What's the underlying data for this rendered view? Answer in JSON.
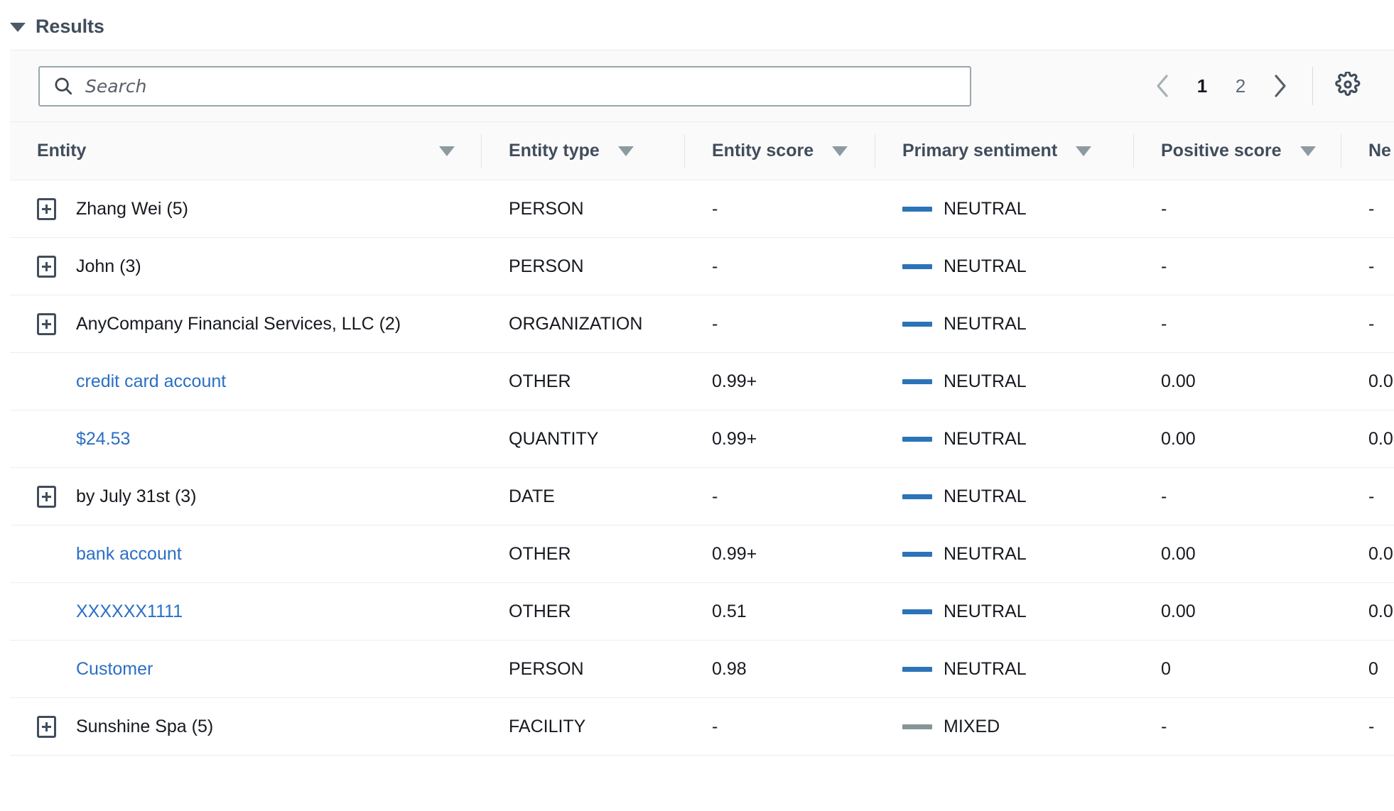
{
  "section": {
    "title": "Results",
    "collapse_icon": "caret-down-icon"
  },
  "toolbar": {
    "search": {
      "placeholder": "Search",
      "value": "",
      "icon": "search-icon"
    },
    "pagination": {
      "prev_icon": "chevron-left-icon",
      "next_icon": "chevron-right-icon",
      "pages": [
        "1",
        "2"
      ],
      "current_page": "1"
    },
    "preferences": {
      "icon": "gear-icon"
    }
  },
  "table": {
    "columns": [
      {
        "label": "Entity",
        "sort_icon": "sort-triangle-icon"
      },
      {
        "label": "Entity type",
        "sort_icon": "sort-triangle-icon"
      },
      {
        "label": "Entity score",
        "sort_icon": "sort-triangle-icon"
      },
      {
        "label": "Primary sentiment",
        "sort_icon": "sort-triangle-icon"
      },
      {
        "label": "Positive score",
        "sort_icon": "sort-triangle-icon"
      },
      {
        "label": "Ne",
        "sort_icon": "sort-triangle-icon"
      }
    ],
    "colors": {
      "neutral": "#2b74b8",
      "mixed": "#879596",
      "link": "#2b6fc4"
    },
    "rows": [
      {
        "expandable": true,
        "is_link": false,
        "entity": "Zhang Wei (5)",
        "entity_type": "PERSON",
        "entity_score": "-",
        "primary_sentiment": "NEUTRAL",
        "sentiment_key": "neutral",
        "positive_score": "-",
        "negative_score": "-"
      },
      {
        "expandable": true,
        "is_link": false,
        "entity": "John (3)",
        "entity_type": "PERSON",
        "entity_score": "-",
        "primary_sentiment": "NEUTRAL",
        "sentiment_key": "neutral",
        "positive_score": "-",
        "negative_score": "-"
      },
      {
        "expandable": true,
        "is_link": false,
        "entity": "AnyCompany Financial Services, LLC (2)",
        "entity_type": "ORGANIZATION",
        "entity_score": "-",
        "primary_sentiment": "NEUTRAL",
        "sentiment_key": "neutral",
        "positive_score": "-",
        "negative_score": "-"
      },
      {
        "expandable": false,
        "is_link": true,
        "entity": "credit card account",
        "entity_type": "OTHER",
        "entity_score": "0.99+",
        "primary_sentiment": "NEUTRAL",
        "sentiment_key": "neutral",
        "positive_score": "0.00",
        "negative_score": "0.0"
      },
      {
        "expandable": false,
        "is_link": true,
        "entity": "$24.53",
        "entity_type": "QUANTITY",
        "entity_score": "0.99+",
        "primary_sentiment": "NEUTRAL",
        "sentiment_key": "neutral",
        "positive_score": "0.00",
        "negative_score": "0.0"
      },
      {
        "expandable": true,
        "is_link": false,
        "entity": "by July 31st (3)",
        "entity_type": "DATE",
        "entity_score": "-",
        "primary_sentiment": "NEUTRAL",
        "sentiment_key": "neutral",
        "positive_score": "-",
        "negative_score": "-"
      },
      {
        "expandable": false,
        "is_link": true,
        "entity": "bank account",
        "entity_type": "OTHER",
        "entity_score": "0.99+",
        "primary_sentiment": "NEUTRAL",
        "sentiment_key": "neutral",
        "positive_score": "0.00",
        "negative_score": "0.0"
      },
      {
        "expandable": false,
        "is_link": true,
        "entity": "XXXXXX1111",
        "entity_type": "OTHER",
        "entity_score": "0.51",
        "primary_sentiment": "NEUTRAL",
        "sentiment_key": "neutral",
        "positive_score": "0.00",
        "negative_score": "0.0"
      },
      {
        "expandable": false,
        "is_link": true,
        "entity": "Customer",
        "entity_type": "PERSON",
        "entity_score": "0.98",
        "primary_sentiment": "NEUTRAL",
        "sentiment_key": "neutral",
        "positive_score": "0",
        "negative_score": "0"
      },
      {
        "expandable": true,
        "is_link": false,
        "entity": "Sunshine Spa (5)",
        "entity_type": "FACILITY",
        "entity_score": "-",
        "primary_sentiment": "MIXED",
        "sentiment_key": "mixed",
        "positive_score": "-",
        "negative_score": "-"
      }
    ]
  }
}
